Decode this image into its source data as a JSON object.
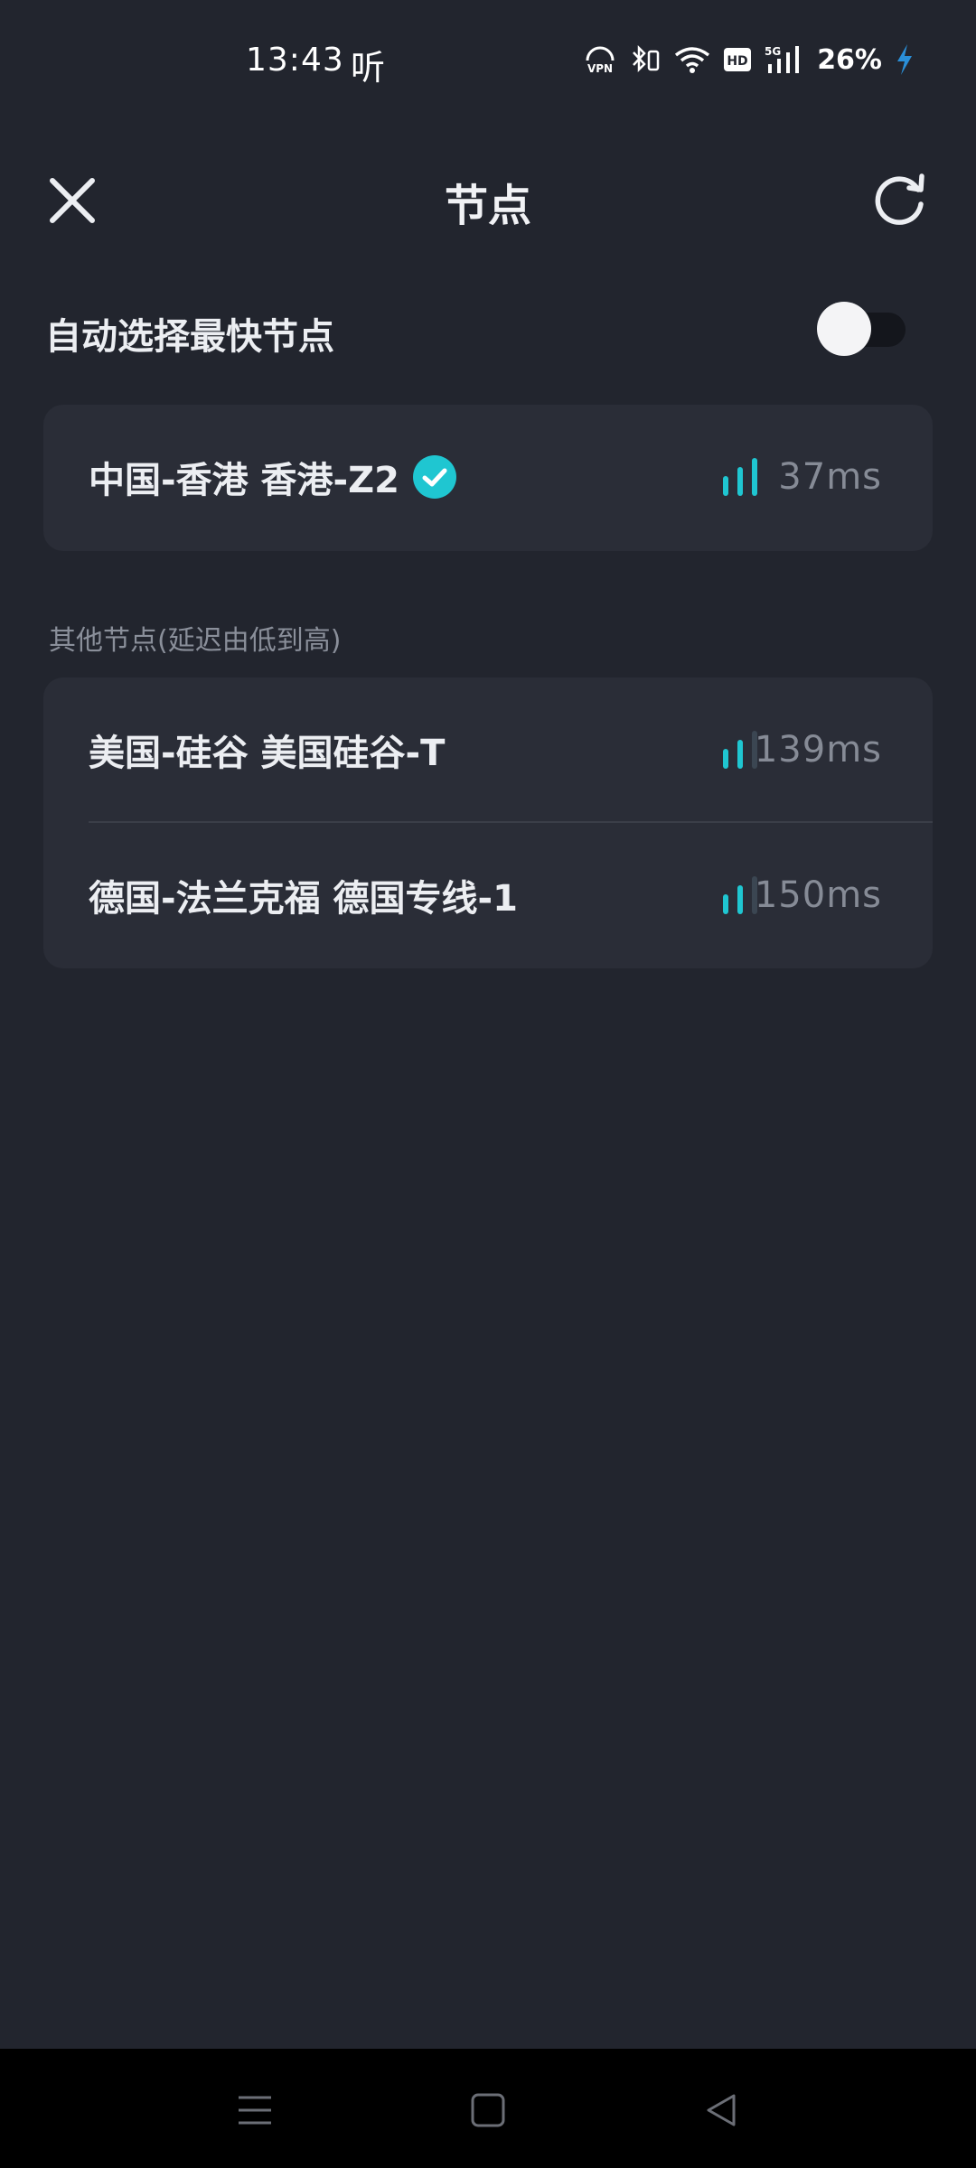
{
  "status_bar": {
    "time": "13:43",
    "listen_glyph": "听",
    "battery": "26%",
    "icons": [
      "vpn-icon",
      "bluetooth-icon",
      "wifi-icon",
      "hd-icon",
      "5g-signal-icon",
      "charging-icon"
    ]
  },
  "header": {
    "title": "节点",
    "close_icon": "close-icon",
    "refresh_icon": "refresh-icon"
  },
  "auto_select": {
    "label": "自动选择最快节点",
    "enabled": false
  },
  "current_node": {
    "name": "中国-香港 香港-Z2",
    "latency": "37ms",
    "signal_level": 3,
    "selected": true
  },
  "others_section": {
    "label": "其他节点(延迟由低到高)",
    "nodes": [
      {
        "name": "美国-硅谷 美国硅谷-T",
        "latency": "139ms",
        "signal_level": 2
      },
      {
        "name": "德国-法兰克福 德国专线-1",
        "latency": "150ms",
        "signal_level": 2
      }
    ]
  },
  "colors": {
    "background": "#22252e",
    "card": "#2a2d37",
    "accent": "#1fc6d1",
    "muted_text": "#868b96"
  },
  "nav_bar": {
    "icons": [
      "menu-icon",
      "home-icon",
      "back-icon"
    ]
  }
}
